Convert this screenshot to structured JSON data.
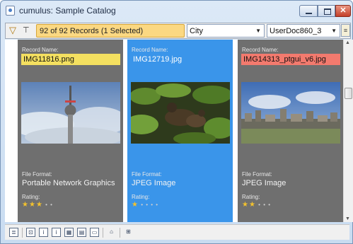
{
  "window": {
    "title": "cumulus: Sample Catalog"
  },
  "toolbar": {
    "records_text": "92 of 92 Records (1 Selected)",
    "view_select": "City",
    "user_select": "UserDoc860_3"
  },
  "records": [
    {
      "record_name_label": "Record Name:",
      "name": "IMG11816.png",
      "label_color": "#f4e060",
      "file_format_label": "File Format:",
      "file_format": "Portable Network Graphics",
      "rating_label": "Rating:",
      "rating": 3,
      "rating_max": 5,
      "selected": false
    },
    {
      "record_name_label": "Record Name:",
      "name": "IMG12719.jpg",
      "label_color": "none",
      "file_format_label": "File Format:",
      "file_format": "JPEG Image",
      "rating_label": "Rating:",
      "rating": 1,
      "rating_max": 5,
      "selected": true
    },
    {
      "record_name_label": "Record Name:",
      "name": "IMG14313_ptgui_v6.jpg",
      "label_color": "#f37a6e",
      "file_format_label": "File Format:",
      "file_format": "JPEG Image",
      "rating_label": "Rating:",
      "rating": 2,
      "rating_max": 5,
      "selected": false
    }
  ],
  "colors": {
    "selected_card": "#3a95ea",
    "card": "#6f6f6f",
    "records_box": "#fbd882"
  },
  "bottom_icons": [
    "info-view-icon",
    "thumbnail-small-icon",
    "thumbnail-info-icon",
    "thumbnail-details-icon",
    "grid-view-icon",
    "list-view-icon",
    "slideshow-icon",
    "collection-basket-icon",
    "preview-icon"
  ]
}
